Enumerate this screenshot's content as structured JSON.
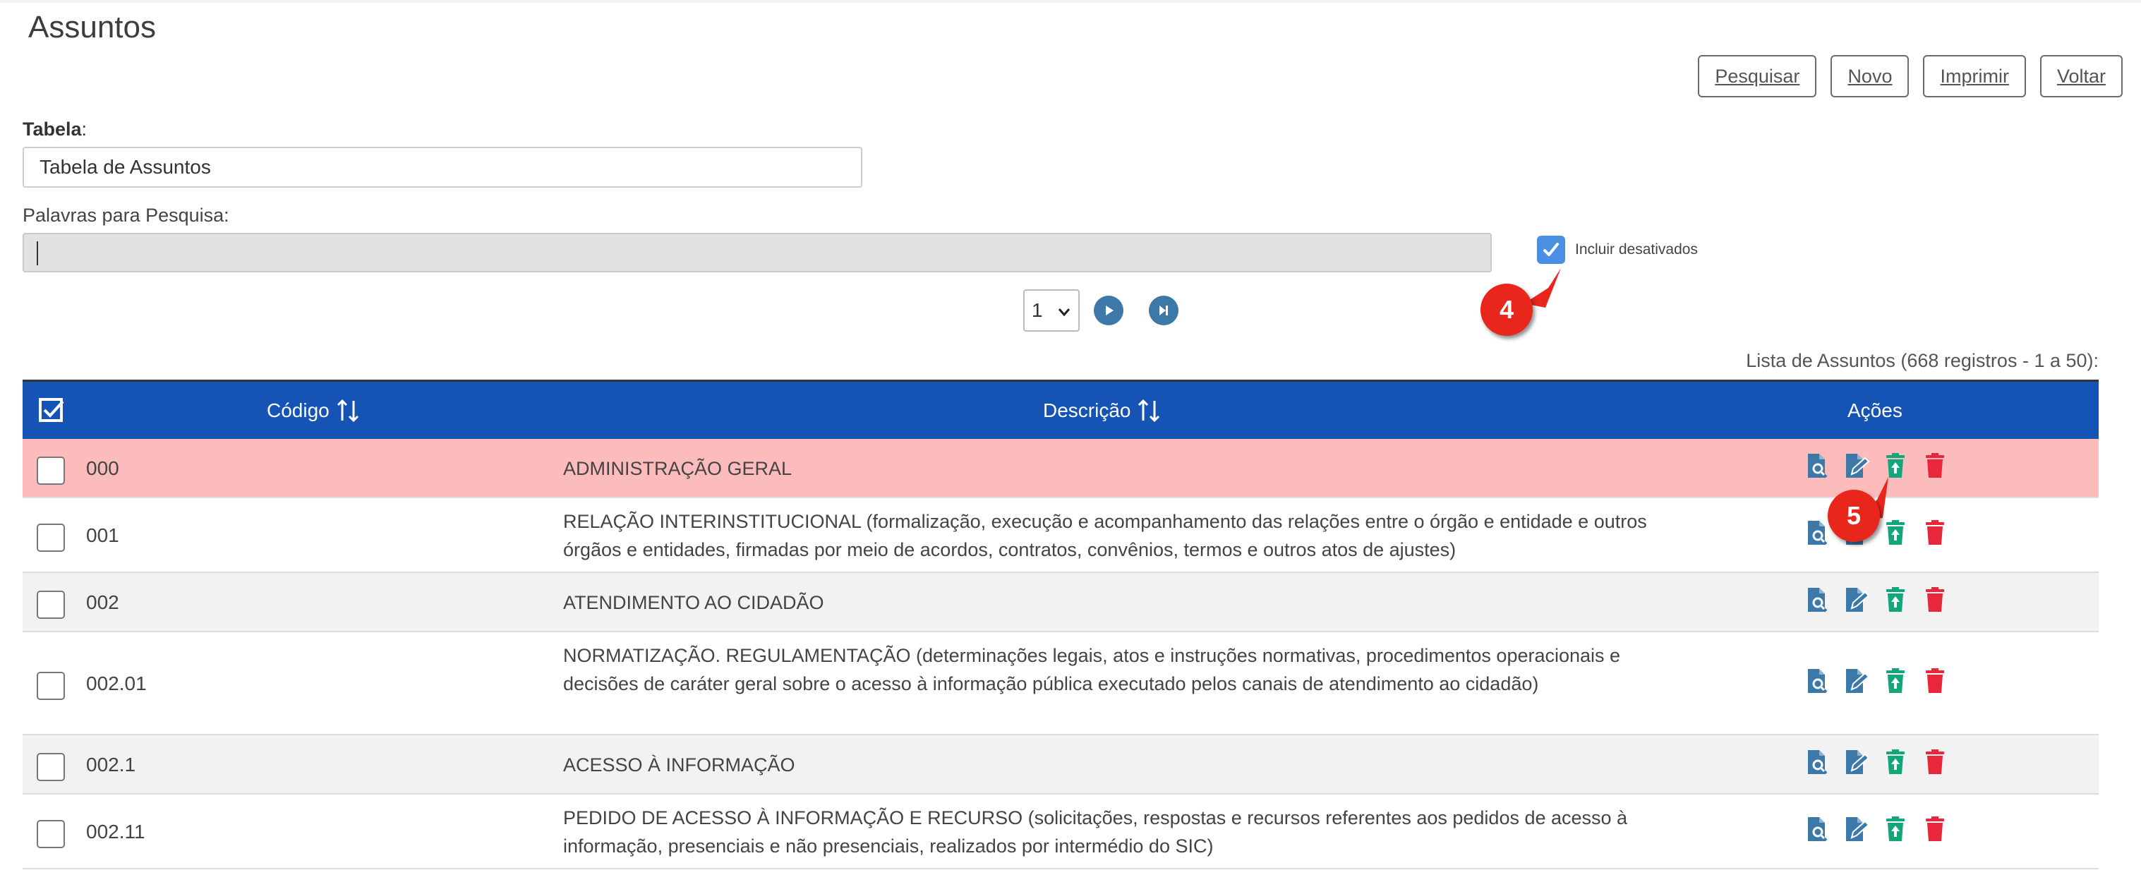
{
  "page": {
    "title": "Assuntos"
  },
  "toolbar": {
    "pesquisar_label": "Pesquisar",
    "novo_label": "Novo",
    "imprimir_label": "Imprimir",
    "voltar_label": "Voltar"
  },
  "form": {
    "tabela_label": "Tabela",
    "tabela_label_suffix": ":",
    "tabela_value": "Tabela de Assuntos",
    "palavras_label": "Palavras para Pesquisa:",
    "palavras_value": "",
    "incluir_desativados_label": "Incluir desativados",
    "incluir_desativados_checked": true
  },
  "pagination": {
    "current_page": "1"
  },
  "annotations": {
    "badge_4": "4",
    "badge_5": "5",
    "color": "#e8261c"
  },
  "list": {
    "caption": "Lista de Assuntos (668 registros - 1 a 50):",
    "headers": {
      "codigo": "Código",
      "descricao": "Descrição",
      "acoes": "Ações"
    },
    "rows": [
      {
        "code": "000",
        "desc": "ADMINISTRAÇÃO GERAL",
        "highlighted": true
      },
      {
        "code": "001",
        "desc": "RELAÇÃO INTERINSTITUCIONAL (formalização, execução e acompanhamento das relações entre o órgão e entidade e outros órgãos e entidades, firmadas por meio de acordos, contratos, convênios, termos e outros atos de ajustes)"
      },
      {
        "code": "002",
        "desc": "ATENDIMENTO AO CIDADÃO"
      },
      {
        "code": "002.01",
        "desc": "NORMATIZAÇÃO. REGULAMENTAÇÃO (determinações legais, atos e instruções normativas, procedimentos operacionais e decisões de caráter geral sobre o acesso à informação pública executado pelos canais de atendimento ao cidadão)"
      },
      {
        "code": "002.1",
        "desc": "ACESSO À INFORMAÇÃO"
      },
      {
        "code": "002.11",
        "desc": "PEDIDO DE ACESSO À INFORMAÇÃO E RECURSO (solicitações, respostas e recursos referentes aos pedidos de acesso à informação, presenciais e não presenciais, realizados por intermédio do SIC)"
      }
    ],
    "action_icons": [
      "view-icon",
      "edit-icon",
      "reactivate-icon",
      "delete-icon"
    ]
  },
  "colors": {
    "header_bg": "#1554b4",
    "highlight_row": "#fcbcbc",
    "alt_row": "#f2f2f2",
    "view_icon": "#3c78a8",
    "edit_icon": "#3c78a8",
    "reactivate_icon": "#12a67a",
    "delete_icon": "#e8283a",
    "checkbox_checked": "#4a90e2"
  }
}
